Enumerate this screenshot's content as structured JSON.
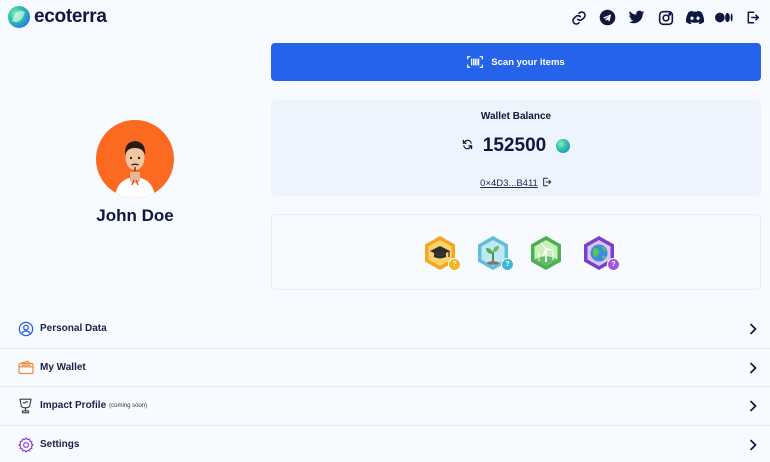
{
  "header": {
    "brand": "ecoterra",
    "social_icons": [
      "link-icon",
      "telegram-icon",
      "twitter-icon",
      "instagram-icon",
      "discord-icon",
      "medium-icon",
      "logout-icon"
    ]
  },
  "profile": {
    "name": "John Doe",
    "avatar_bg": "#fb6a20"
  },
  "scan": {
    "label": "Scan your items"
  },
  "wallet": {
    "title": "Wallet Balance",
    "balance": "152500",
    "address": "0×4D3...B411"
  },
  "badges": [
    {
      "icon": "graduation-cap-badge-icon",
      "status": "?"
    },
    {
      "icon": "plant-badge-icon",
      "status": "?"
    },
    {
      "icon": "wind-turbine-badge-icon",
      "status": ""
    },
    {
      "icon": "earth-badge-icon",
      "status": "?"
    }
  ],
  "menu": [
    {
      "label": "Personal Data",
      "note": "",
      "icon": "user-circle-icon"
    },
    {
      "label": "My Wallet",
      "note": "",
      "icon": "wallet-icon"
    },
    {
      "label": "Impact Profile",
      "note": "(coming soon)",
      "icon": "trophy-icon"
    },
    {
      "label": "Settings",
      "note": "",
      "icon": "gear-icon"
    }
  ],
  "colors": {
    "accent": "#2563eb",
    "background": "#f7faff",
    "card": "#edf4fd",
    "text": "#0f1740"
  }
}
